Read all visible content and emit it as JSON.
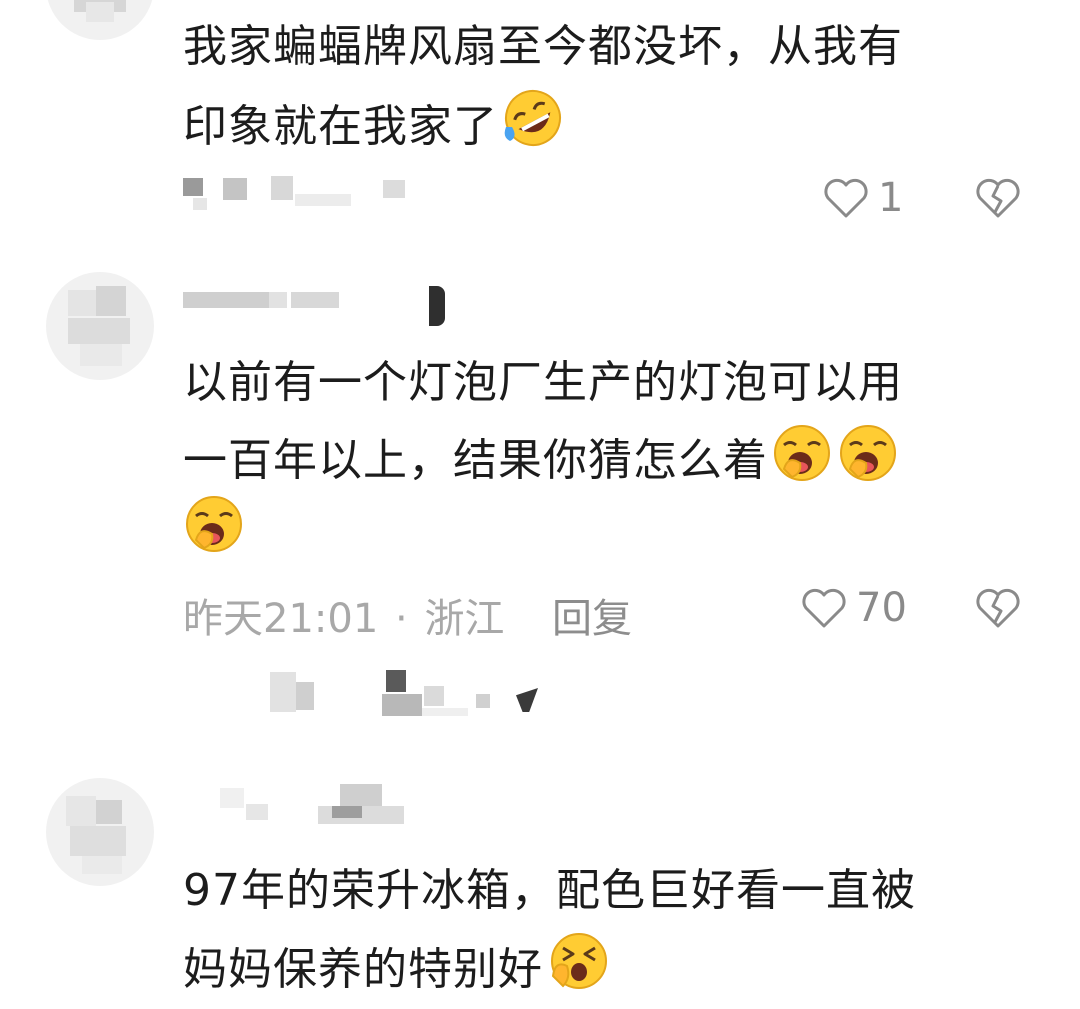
{
  "comments": [
    {
      "text_line1": "我家蝙蝠牌风扇至今都没坏，从我有",
      "text_line2": "印象就在我家了",
      "like_count": "1"
    },
    {
      "text_line1": "以前有一个灯泡厂生产的灯泡可以用",
      "text_line2": "一百年以上，结果你猜怎么着",
      "time": "昨天21:01",
      "separator": "·",
      "location": "浙江",
      "reply_label": "回复",
      "like_count": "70"
    },
    {
      "text_line1": "97年的荣升冰箱，配色巨好看一直被",
      "text_line2": "妈妈保养的特别好"
    }
  ],
  "icons": {
    "like": "heart-outline-icon",
    "dislike": "broken-heart-icon",
    "emoji_laugh_cry": "rofl-emoji-icon",
    "emoji_yawn": "yawning-face-emoji-icon",
    "emoji_shh": "squinting-hand-over-mouth-emoji-icon"
  },
  "colors": {
    "text": "#1c1c1c",
    "meta": "#a8a8a8",
    "icon": "#8a8a8a",
    "emoji_yellow": "#ffcc33"
  }
}
